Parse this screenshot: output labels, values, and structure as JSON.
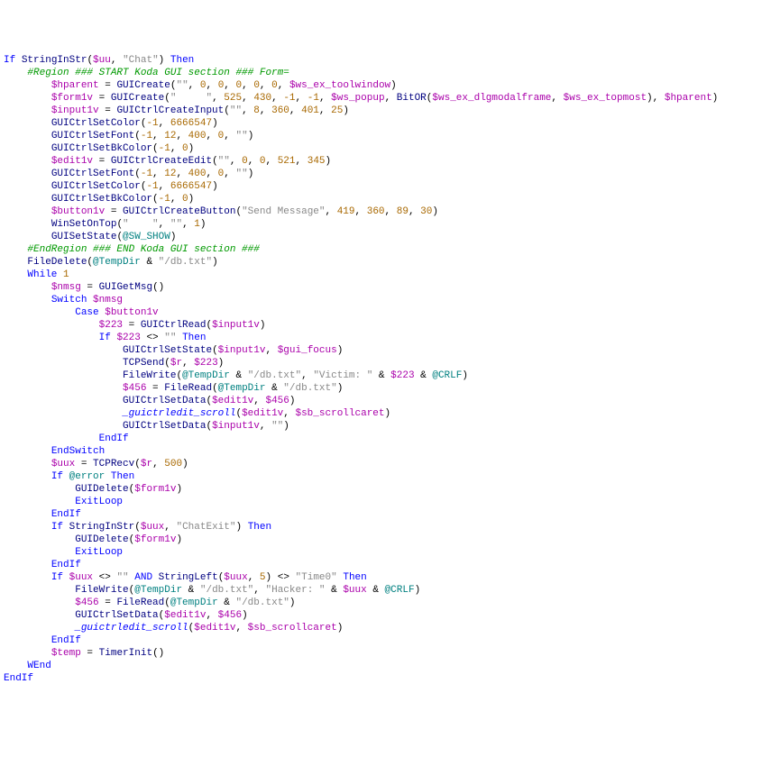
{
  "code": {
    "chat_literal": "\"Chat\"",
    "region_start": "#Region ### START Koda GUI section ### Form=",
    "guicreate_empty": "\"\"",
    "ws_ex_toolwindow": "$ws_ex_toolwindow",
    "hparent": "$hparent",
    "form1v": "$form1v",
    "spaces5": "\"     \"",
    "n525": "525",
    "n430": "430",
    "neg1": "-1",
    "ws_popup": "$ws_popup",
    "bitor": "BitOR",
    "ws_ex_dlgmodalframe": "$ws_ex_dlgmodalframe",
    "ws_ex_topmost": "$ws_ex_topmost",
    "input1v": "$input1v",
    "n8": "8",
    "n360": "360",
    "n401": "401",
    "n25": "25",
    "n6666547": "6666547",
    "n12": "12",
    "n400": "400",
    "n0": "0",
    "edit1v": "$edit1v",
    "n521": "521",
    "n345": "345",
    "button1v": "$button1v",
    "send_msg": "\"Send Message\"",
    "n419": "419",
    "n89": "89",
    "n30": "30",
    "spaces4": "\"    \"",
    "n1": "1",
    "sw_show": "@SW_SHOW",
    "region_end": "#EndRegion ### END Koda GUI section ###",
    "tempdir": "@TempDir",
    "dbtxt": "\"/db.txt\"",
    "nmsg": "$nmsg",
    "v223": "$223",
    "gui_focus": "$gui_focus",
    "r": "$r",
    "victim": "\"Victim: \"",
    "crlf": "@CRLF",
    "v456": "$456",
    "sb_scrollcaret": "$sb_scrollcaret",
    "uux": "$uux",
    "n500": "500",
    "error": "@error",
    "chatexit": "\"ChatExit\"",
    "n5": "5",
    "time0": "\"Time0\"",
    "hacker": "\"Hacker: \"",
    "temp": "$temp",
    "uu": "$uu"
  }
}
